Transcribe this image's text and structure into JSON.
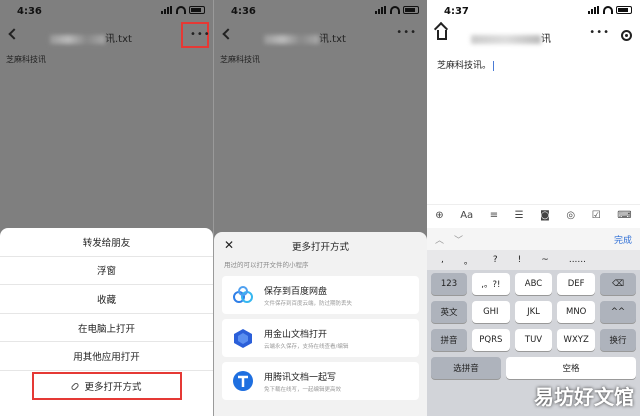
{
  "panel1": {
    "time": "4:36",
    "title_suffix": "讯.txt",
    "doc_text": "芝麻科技讯",
    "menu_items": [
      "转发给朋友",
      "浮窗",
      "收藏",
      "在电脑上打开",
      "用其他应用打开"
    ],
    "highlighted_item": "更多打开方式"
  },
  "panel2": {
    "time": "4:36",
    "title_suffix": "讯.txt",
    "doc_text": "芝麻科技讯",
    "sheet_title": "更多打开方式",
    "hint": "用过的可以打开文件的小程序",
    "cards": [
      {
        "name": "保存到百度网盘",
        "desc": "文件保存到百度云端，防过期防丢失"
      },
      {
        "name": "用金山文档打开",
        "desc": "云端永久保存，支持在线查看/编辑"
      },
      {
        "name": "用腾讯文档一起写",
        "desc": "免下载在线写，一起编辑更高效"
      }
    ]
  },
  "panel3": {
    "time": "4:37",
    "title_suffix": "讯",
    "editor_text": "芝麻科技讯。",
    "done_label": "完成",
    "candidates": [
      ",",
      "。",
      "?",
      "!",
      "~",
      "......"
    ],
    "rows": [
      [
        "123",
        ",。?!",
        "ABC",
        "DEF",
        "⌫"
      ],
      [
        "英文",
        "GHI",
        "JKL",
        "MNO",
        "^^"
      ],
      [
        "拼音",
        "PQRS",
        "TUV",
        "WXYZ",
        "换行"
      ],
      [
        "选拼音",
        "空格"
      ]
    ]
  },
  "watermark": "易坊好文馆"
}
